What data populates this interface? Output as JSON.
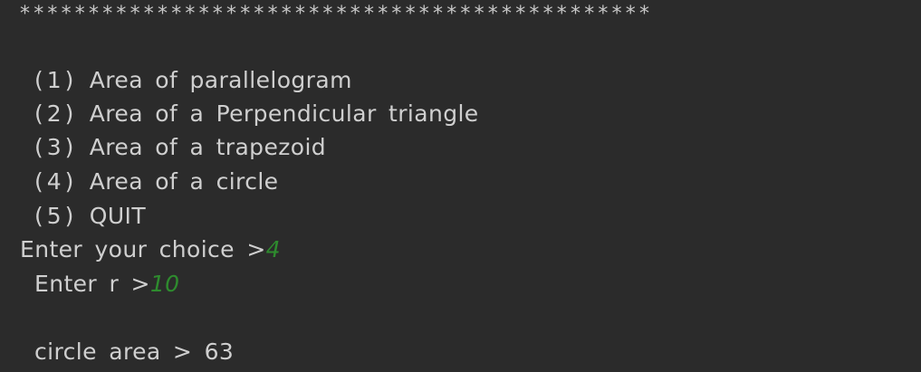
{
  "console": {
    "separator": "**********************************************",
    "menu": [
      {
        "num": "(1)",
        "label": "Area of parallelogram"
      },
      {
        "num": "(2)",
        "label": "Area of a Perpendicular triangle"
      },
      {
        "num": "(3)",
        "label": "Area of a trapezoid"
      },
      {
        "num": "(4)",
        "label": "Area of a circle"
      },
      {
        "num": "(5)",
        "label": "QUIT"
      }
    ],
    "choice_prompt": "Enter your choice >",
    "choice_value": "4",
    "r_prompt": "Enter r >",
    "r_value": "10",
    "result": "circle area > 63"
  },
  "colors": {
    "background": "#2b2b2b",
    "text": "#cfcfcf",
    "input": "#2e8b2e"
  }
}
